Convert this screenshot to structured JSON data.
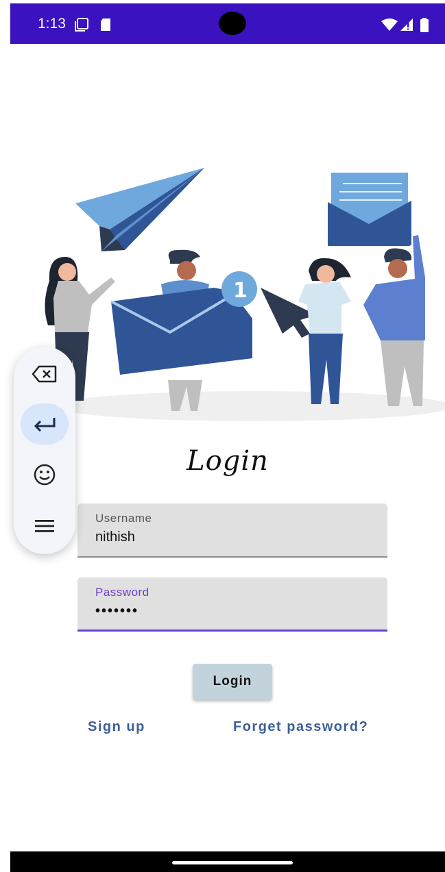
{
  "status_bar": {
    "time": "1:13",
    "icons": [
      "screen-recording-icon",
      "sd-card-icon",
      "wifi-icon",
      "signal-icon",
      "battery-icon"
    ]
  },
  "illustration": {
    "description_icon": "people-with-envelopes-illustration",
    "badge_number": "1"
  },
  "login_form": {
    "title": "Login",
    "username": {
      "label": "Username",
      "value": "nithish"
    },
    "password": {
      "label": "Password",
      "value": "•••••••"
    },
    "login_button": "Login",
    "signup_link": "Sign up",
    "forget_link": "Forget password?"
  },
  "keyboard_toolbar": {
    "buttons": [
      "backspace-icon",
      "enter-icon",
      "emoji-icon",
      "menu-icon"
    ]
  },
  "colors": {
    "status_bar": "#3a12bf",
    "accent": "#6a3fc9",
    "link": "#3e5e97",
    "button_bg": "#c3d3dc"
  }
}
